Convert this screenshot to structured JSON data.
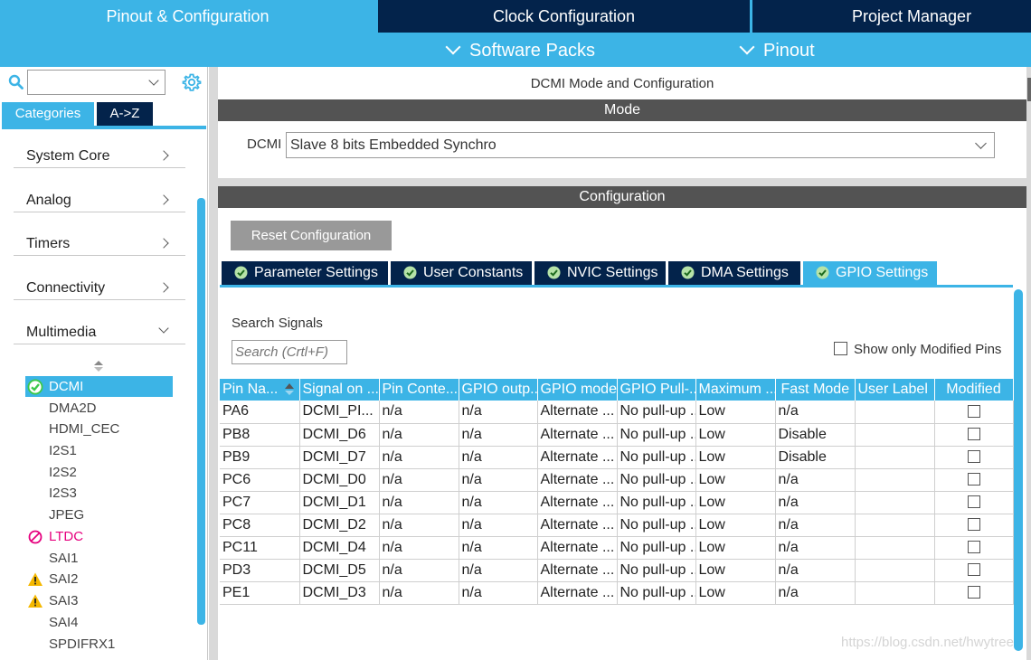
{
  "top_nav": {
    "tabs": [
      {
        "label": "Pinout & Configuration"
      },
      {
        "label": "Clock Configuration"
      },
      {
        "label": "Project Manager"
      }
    ],
    "sub_tabs": [
      {
        "label": "Software Packs"
      },
      {
        "label": "Pinout"
      }
    ]
  },
  "sidebar": {
    "search_value": "",
    "view_tabs": [
      {
        "label": "Categories"
      },
      {
        "label": "A->Z"
      }
    ],
    "categories": [
      {
        "label": "System Core"
      },
      {
        "label": "Analog"
      },
      {
        "label": "Timers"
      },
      {
        "label": "Connectivity"
      },
      {
        "label": "Multimedia"
      }
    ],
    "peripherals": [
      {
        "label": "DCMI",
        "status": "ok"
      },
      {
        "label": "DMA2D",
        "status": ""
      },
      {
        "label": "HDMI_CEC",
        "status": ""
      },
      {
        "label": "I2S1",
        "status": ""
      },
      {
        "label": "I2S2",
        "status": ""
      },
      {
        "label": "I2S3",
        "status": ""
      },
      {
        "label": "JPEG",
        "status": ""
      },
      {
        "label": "LTDC",
        "status": "error"
      },
      {
        "label": "SAI1",
        "status": ""
      },
      {
        "label": "SAI2",
        "status": "warning"
      },
      {
        "label": "SAI3",
        "status": "warning"
      },
      {
        "label": "SAI4",
        "status": ""
      },
      {
        "label": "SPDIFRX1",
        "status": ""
      }
    ]
  },
  "mode_panel": {
    "title": "DCMI Mode and Configuration",
    "mode_header": "Mode",
    "dcmi_label": "DCMI",
    "dcmi_value": "Slave 8 bits Embedded Synchro"
  },
  "config_panel": {
    "header": "Configuration",
    "reset_label": "Reset Configuration",
    "tabs": [
      {
        "label": "Parameter Settings"
      },
      {
        "label": "User Constants"
      },
      {
        "label": "NVIC Settings"
      },
      {
        "label": "DMA Settings"
      },
      {
        "label": "GPIO Settings"
      }
    ],
    "search_label": "Search Signals",
    "search_placeholder": "Search (Crtl+F)",
    "only_modified_label": "Show only Modified Pins",
    "table": {
      "columns": [
        "Pin Na...",
        "Signal on ...",
        "Pin Conte...",
        "GPIO outp...",
        "GPIO mode",
        "GPIO Pull-...",
        "Maximum ...",
        "Fast Mode",
        "User Label",
        "Modified"
      ],
      "rows": [
        [
          "PA6",
          "DCMI_PI...",
          "n/a",
          "n/a",
          "Alternate ...",
          "No pull-up ...",
          "Low",
          "n/a",
          ""
        ],
        [
          "PB8",
          "DCMI_D6",
          "n/a",
          "n/a",
          "Alternate ...",
          "No pull-up ...",
          "Low",
          "Disable",
          ""
        ],
        [
          "PB9",
          "DCMI_D7",
          "n/a",
          "n/a",
          "Alternate ...",
          "No pull-up ...",
          "Low",
          "Disable",
          ""
        ],
        [
          "PC6",
          "DCMI_D0",
          "n/a",
          "n/a",
          "Alternate ...",
          "No pull-up ...",
          "Low",
          "n/a",
          ""
        ],
        [
          "PC7",
          "DCMI_D1",
          "n/a",
          "n/a",
          "Alternate ...",
          "No pull-up ...",
          "Low",
          "n/a",
          ""
        ],
        [
          "PC8",
          "DCMI_D2",
          "n/a",
          "n/a",
          "Alternate ...",
          "No pull-up ...",
          "Low",
          "n/a",
          ""
        ],
        [
          "PC11",
          "DCMI_D4",
          "n/a",
          "n/a",
          "Alternate ...",
          "No pull-up ...",
          "Low",
          "n/a",
          ""
        ],
        [
          "PD3",
          "DCMI_D5",
          "n/a",
          "n/a",
          "Alternate ...",
          "No pull-up ...",
          "Low",
          "n/a",
          ""
        ],
        [
          "PE1",
          "DCMI_D3",
          "n/a",
          "n/a",
          "Alternate ...",
          "No pull-up ...",
          "Low",
          "n/a",
          ""
        ]
      ]
    }
  },
  "watermark": "https://blog.csdn.net/hwytree",
  "colors": {
    "accent": "#3cb4e6",
    "dark": "#03234b",
    "section_bar": "#535353",
    "error": "#e6007e",
    "warning": "#f5b800",
    "ok": "#3cc84a"
  }
}
